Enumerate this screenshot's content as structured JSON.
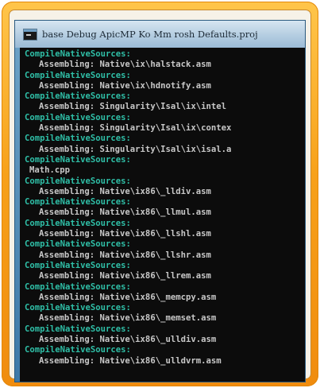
{
  "window": {
    "title": "base Debug ApicMP Ko Mm  rosh  Defaults.proj",
    "icon": "console-icon"
  },
  "colors": {
    "frame": "#f7a11a",
    "header_text": "#2fbfa7",
    "detail_text": "#c8c8c8",
    "console_bg": "#0c0c0c"
  },
  "console": {
    "lines": [
      {
        "kind": "header",
        "text": "CompileNativeSources:"
      },
      {
        "kind": "detail",
        "text": "Assembling: Native\\ix\\halstack.asm"
      },
      {
        "kind": "header",
        "text": "CompileNativeSources:"
      },
      {
        "kind": "detail",
        "text": "Assembling: Native\\ix\\hdnotify.asm"
      },
      {
        "kind": "header",
        "text": "CompileNativeSources:"
      },
      {
        "kind": "detail",
        "text": "Assembling: Singularity\\Isal\\ix\\intel"
      },
      {
        "kind": "header",
        "text": "CompileNativeSources:"
      },
      {
        "kind": "detail",
        "text": "Assembling: Singularity\\Isal\\ix\\contex"
      },
      {
        "kind": "header",
        "text": "CompileNativeSources:"
      },
      {
        "kind": "detail",
        "text": "Assembling: Singularity\\Isal\\ix\\isal.a"
      },
      {
        "kind": "header",
        "text": "CompileNativeSources:"
      },
      {
        "kind": "source",
        "text": "Math.cpp"
      },
      {
        "kind": "header",
        "text": "CompileNativeSources:"
      },
      {
        "kind": "detail",
        "text": "Assembling: Native\\ix86\\_lldiv.asm"
      },
      {
        "kind": "header",
        "text": "CompileNativeSources:"
      },
      {
        "kind": "detail",
        "text": "Assembling: Native\\ix86\\_llmul.asm"
      },
      {
        "kind": "header",
        "text": "CompileNativeSources:"
      },
      {
        "kind": "detail",
        "text": "Assembling: Native\\ix86\\_llshl.asm"
      },
      {
        "kind": "header",
        "text": "CompileNativeSources:"
      },
      {
        "kind": "detail",
        "text": "Assembling: Native\\ix86\\_llshr.asm"
      },
      {
        "kind": "header",
        "text": "CompileNativeSources:"
      },
      {
        "kind": "detail",
        "text": "Assembling: Native\\ix86\\_llrem.asm"
      },
      {
        "kind": "header",
        "text": "CompileNativeSources:"
      },
      {
        "kind": "detail",
        "text": "Assembling: Native\\ix86\\_memcpy.asm"
      },
      {
        "kind": "header",
        "text": "CompileNativeSources:"
      },
      {
        "kind": "detail",
        "text": "Assembling: Native\\ix86\\_memset.asm"
      },
      {
        "kind": "header",
        "text": "CompileNativeSources:"
      },
      {
        "kind": "detail",
        "text": "Assembling: Native\\ix86\\_ulldiv.asm"
      },
      {
        "kind": "header",
        "text": "CompileNativeSources:"
      },
      {
        "kind": "detail",
        "text": "Assembling: Native\\ix86\\_ulldvrm.asm"
      }
    ]
  }
}
